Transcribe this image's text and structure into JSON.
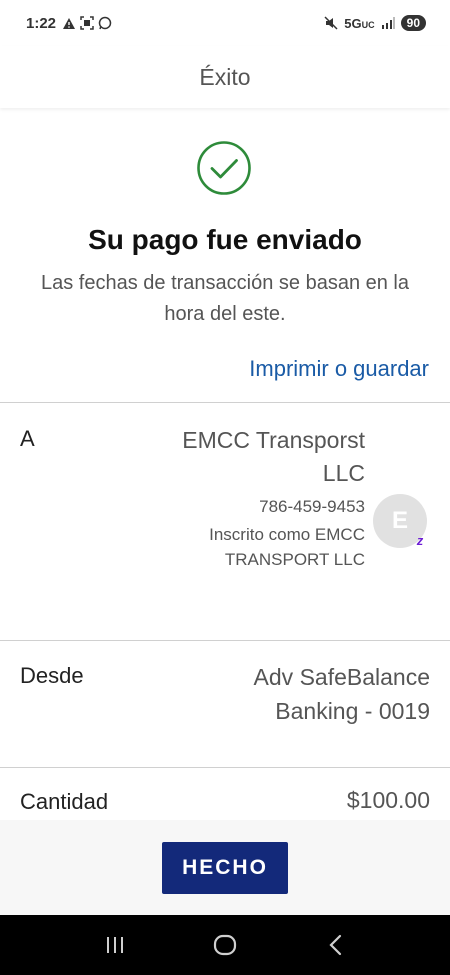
{
  "status_bar": {
    "time": "1:22",
    "network": "5G",
    "network_sub": "UC",
    "battery": "90"
  },
  "header": {
    "title": "Éxito"
  },
  "confirmation": {
    "title": "Su pago fue enviado",
    "note": "Las fechas de transacción se basan en la hora del este.",
    "print_link": "Imprimir o guardar"
  },
  "details": {
    "to": {
      "label": "A",
      "name": "EMCC Transporst LLC",
      "phone": "786-459-9453",
      "enrolled": "Inscrito como EMCC TRANSPORT LLC",
      "avatar_letter": "E",
      "badge": "z"
    },
    "from": {
      "label": "Desde",
      "account": "Adv SafeBalance Banking - 0019"
    },
    "amount": {
      "label": "Cantidad",
      "value": "$100.00"
    }
  },
  "actions": {
    "done_label": "HECHO"
  },
  "colors": {
    "success_green": "#2e8b3a",
    "link_blue": "#1a5ba6",
    "button_navy": "#13297a",
    "zelle_purple": "#6d1ed4"
  },
  "icons": {
    "success": "check-circle-icon",
    "nav_recents": "recents-icon",
    "nav_home": "home-icon",
    "nav_back": "back-icon"
  }
}
